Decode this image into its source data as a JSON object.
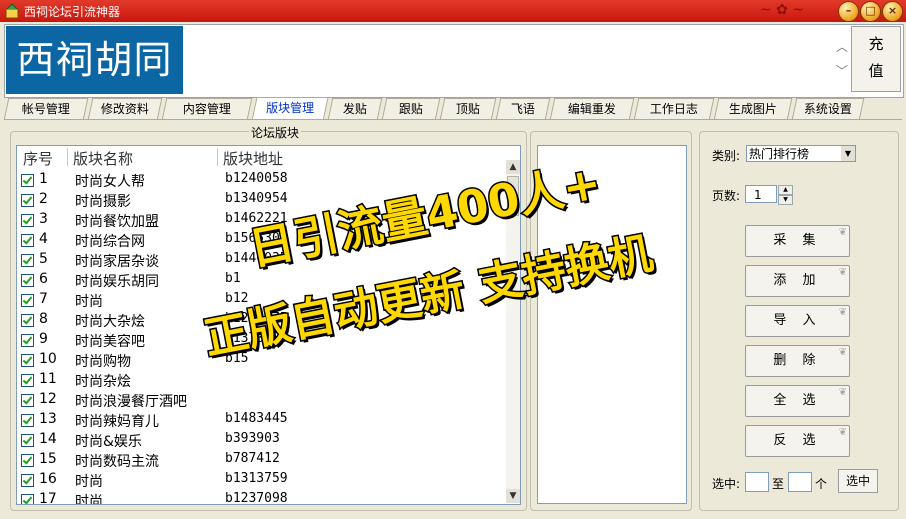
{
  "window": {
    "title": "西祠论坛引流神器",
    "min_label": "–",
    "max_label": "□",
    "close_label": "×"
  },
  "header": {
    "logo": "西祠胡同",
    "recharge": "充\n值"
  },
  "tabs": [
    "帐号管理",
    "修改资料",
    "内容管理",
    "版块管理",
    "发贴",
    "跟贴",
    "顶贴",
    "飞语",
    "编辑重发",
    "工作日志",
    "生成图片",
    "系统设置"
  ],
  "active_tab": "版块管理",
  "forum": {
    "group_title": "论坛版块",
    "columns": [
      "序号",
      "版块名称",
      "版块地址"
    ],
    "rows": [
      {
        "no": "1",
        "name": "时尚女人帮",
        "url": "b1240058"
      },
      {
        "no": "2",
        "name": "时尚摄影",
        "url": "b1340954"
      },
      {
        "no": "3",
        "name": "时尚餐饮加盟",
        "url": "b1462221"
      },
      {
        "no": "4",
        "name": "时尚综合网",
        "url": "b1565307"
      },
      {
        "no": "5",
        "name": "时尚家居杂谈",
        "url": "b1440035"
      },
      {
        "no": "6",
        "name": "时尚娱乐胡同",
        "url": "b1"
      },
      {
        "no": "7",
        "name": "时尚",
        "url": "b12"
      },
      {
        "no": "8",
        "name": "时尚大杂烩",
        "url": "b1293075"
      },
      {
        "no": "9",
        "name": "时尚美容吧",
        "url": "b1370305"
      },
      {
        "no": "10",
        "name": "时尚购物",
        "url": "b15"
      },
      {
        "no": "11",
        "name": "时尚杂烩",
        "url": ""
      },
      {
        "no": "12",
        "name": "时尚浪漫餐厅酒吧",
        "url": ""
      },
      {
        "no": "13",
        "name": "时尚辣妈育儿",
        "url": "b1483445"
      },
      {
        "no": "14",
        "name": "时尚&娱乐",
        "url": "b393903"
      },
      {
        "no": "15",
        "name": "时尚数码主流",
        "url": "b787412"
      },
      {
        "no": "16",
        "name": "时尚",
        "url": "b1313759"
      },
      {
        "no": "17",
        "name": "时尚",
        "url": "b1237098"
      }
    ]
  },
  "controls": {
    "category_label": "类别:",
    "category_value": "热门排行榜",
    "pages_label": "页数:",
    "pages_value": "1",
    "buttons": [
      "采 集",
      "添 加",
      "导 入",
      "删 除",
      "全 选",
      "反 选"
    ],
    "select_label": "选中:",
    "to_label": "至",
    "unit_label": "个",
    "select_button": "选中"
  },
  "overlay": {
    "line1": "日引流量400人+",
    "line2": "正版自动更新 支持换机"
  }
}
